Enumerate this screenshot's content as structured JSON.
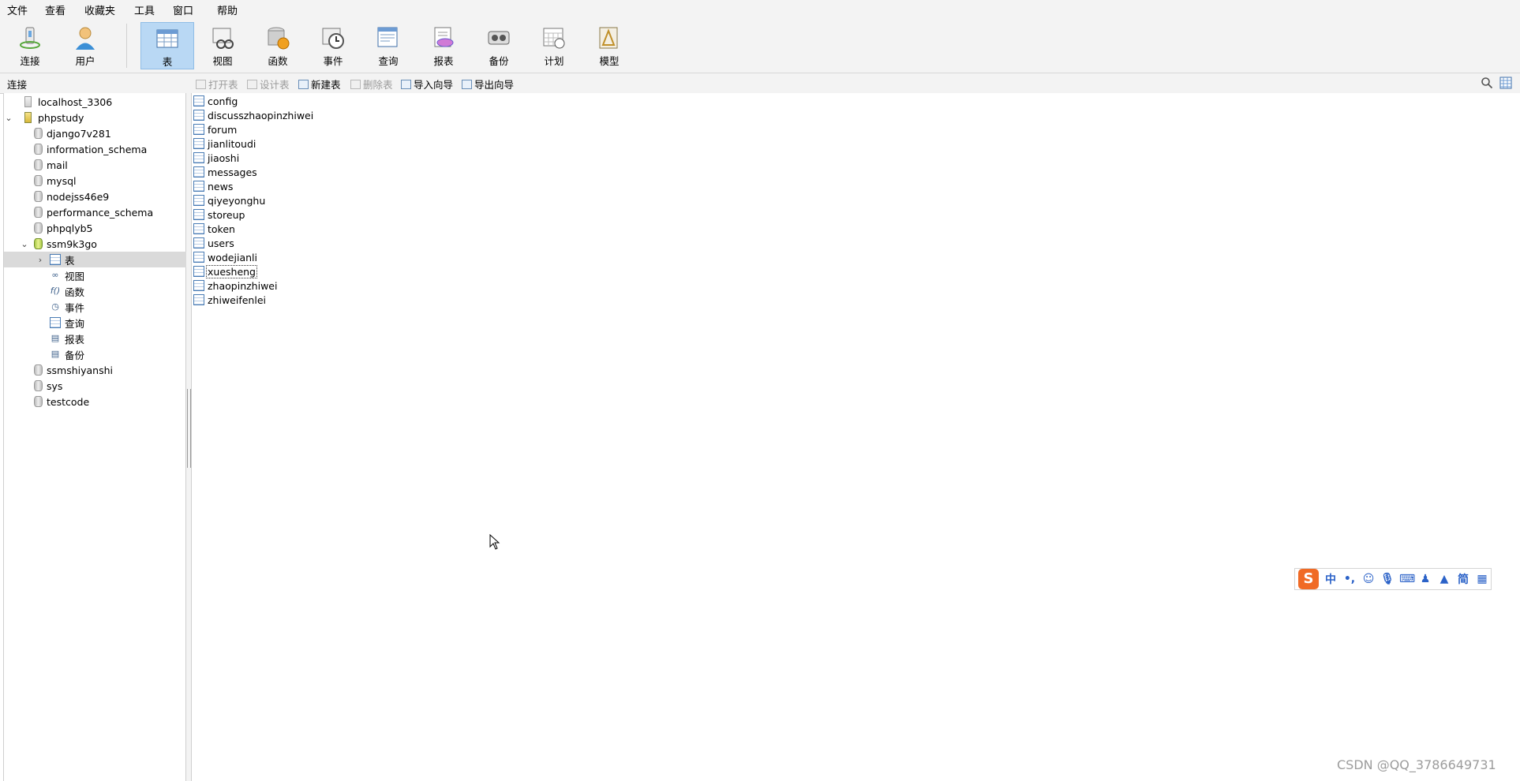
{
  "menubar": [
    "文件",
    "查看",
    "收藏夹",
    "工具",
    "窗口",
    "帮助"
  ],
  "toolbar": {
    "items": [
      {
        "label": "连接",
        "icon": "connect-icon"
      },
      {
        "label": "用户",
        "icon": "user-icon"
      },
      {
        "label": "表",
        "icon": "table-icon",
        "active": true
      },
      {
        "label": "视图",
        "icon": "view-icon"
      },
      {
        "label": "函数",
        "icon": "function-icon"
      },
      {
        "label": "事件",
        "icon": "event-icon"
      },
      {
        "label": "查询",
        "icon": "query-icon"
      },
      {
        "label": "报表",
        "icon": "report-icon"
      },
      {
        "label": "备份",
        "icon": "backup-icon"
      },
      {
        "label": "计划",
        "icon": "schedule-icon"
      },
      {
        "label": "模型",
        "icon": "model-icon"
      }
    ]
  },
  "connection_panel": {
    "label": "连接"
  },
  "object_toolbar": {
    "open_table": "打开表",
    "design_table": "设计表",
    "new_table": "新建表",
    "delete_table": "删除表",
    "import_wizard": "导入向导",
    "export_wizard": "导出向导"
  },
  "tree": {
    "server_local": "localhost_3306",
    "server_phpstudy": "phpstudy",
    "databases_before": [
      "django7v281",
      "information_schema",
      "mail",
      "mysql",
      "nodejss46e9",
      "performance_schema",
      "phpqlyb5"
    ],
    "open_db": "ssm9k3go",
    "open_db_children": [
      "表",
      "视图",
      "函数",
      "事件",
      "查询",
      "报表",
      "备份"
    ],
    "databases_after": [
      "ssmshiyanshi",
      "sys",
      "testcode"
    ]
  },
  "tables": [
    "config",
    "discusszhaopinzhiwei",
    "forum",
    "jianlitoudi",
    "jiaoshi",
    "messages",
    "news",
    "qiyeyonghu",
    "storeup",
    "token",
    "users",
    "wodejianli",
    "xuesheng",
    "zhaopinzhiwei",
    "zhiweifenlei"
  ],
  "focused_table": "xuesheng",
  "ime": {
    "logo": "S",
    "mode": "中",
    "punct": "•,",
    "simplified": "简"
  },
  "watermark": "CSDN @QQ_3786649731"
}
